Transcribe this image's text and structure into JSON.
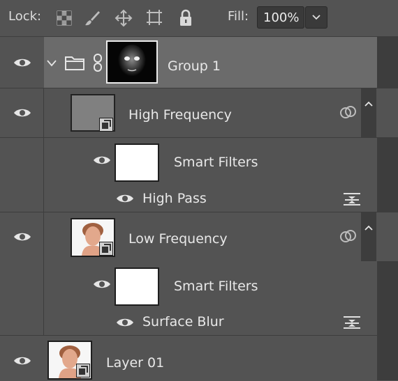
{
  "toolbar": {
    "lock_label": "Lock:",
    "fill_label": "Fill:",
    "fill_value": "100%"
  },
  "layers": {
    "group": {
      "name": "Group 1"
    },
    "high_frequency": {
      "name": "High Frequency"
    },
    "high_smart_filters": {
      "name": "Smart Filters"
    },
    "high_pass": {
      "name": "High Pass"
    },
    "low_frequency": {
      "name": "Low Frequency"
    },
    "low_smart_filters": {
      "name": "Smart Filters"
    },
    "surface_blur": {
      "name": "Surface Blur"
    },
    "layer01": {
      "name": "Layer 01"
    }
  },
  "colors": {
    "panel_bg": "#535353",
    "selected_row": "#6b6b6b",
    "divider": "#3d3d3d",
    "high_freq_thumb": "#808080"
  }
}
